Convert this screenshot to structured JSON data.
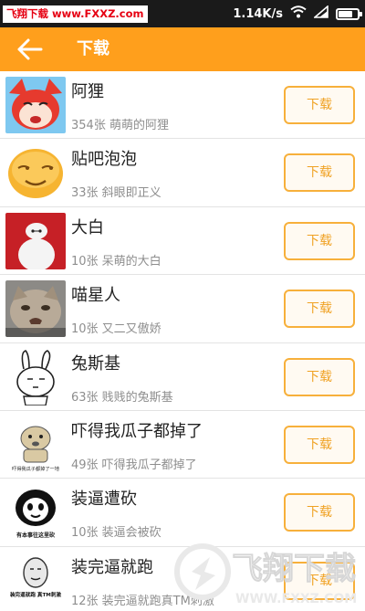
{
  "status_bar": {
    "watermark": "飞翔下载 www.FXXZ.com",
    "speed": "1.14K/s",
    "battery_level": 0.75,
    "icons": [
      "wifi-icon",
      "signal-icon",
      "battery-icon"
    ]
  },
  "app_bar": {
    "back_icon": "arrow-left-icon",
    "title": "下载",
    "color": "#ff9f1c"
  },
  "items": [
    {
      "name": "阿狸",
      "desc": "354张 萌萌的阿狸",
      "button": "下载",
      "icon": "ahri-fox-thumbnail"
    },
    {
      "name": "贴吧泡泡",
      "desc": "33张 斜眼即正义",
      "button": "下载",
      "icon": "smiley-face-thumbnail"
    },
    {
      "name": "大白",
      "desc": "10张 呆萌的大白",
      "button": "下载",
      "icon": "baymax-thumbnail"
    },
    {
      "name": "喵星人",
      "desc": "10张 又二又傲娇",
      "button": "下载",
      "icon": "cat-thumbnail"
    },
    {
      "name": "兔斯基",
      "desc": "63张 贱贱的兔斯基",
      "button": "下载",
      "icon": "tuzki-thumbnail"
    },
    {
      "name": "吓得我瓜子都掉了",
      "desc": "49张 吓得我瓜子都掉了",
      "button": "下载",
      "icon": "hamster-thumbnail",
      "thumb_caption": "吓得我瓜子都掉了一地"
    },
    {
      "name": "装逼遭砍",
      "desc": "10张 装逼会被砍",
      "button": "下载",
      "icon": "panda-meme-thumbnail",
      "thumb_caption": "有本事往这里砍"
    },
    {
      "name": "装完逼就跑",
      "desc": "12张 装完逼就跑真TM刺激",
      "button": "下载",
      "icon": "meme-face-thumbnail",
      "thumb_caption": "装完逼就跑 真TM刺激"
    }
  ],
  "watermark_bottom": {
    "title": "飞翔下载",
    "url": "WWW.FXXZ.COM"
  }
}
